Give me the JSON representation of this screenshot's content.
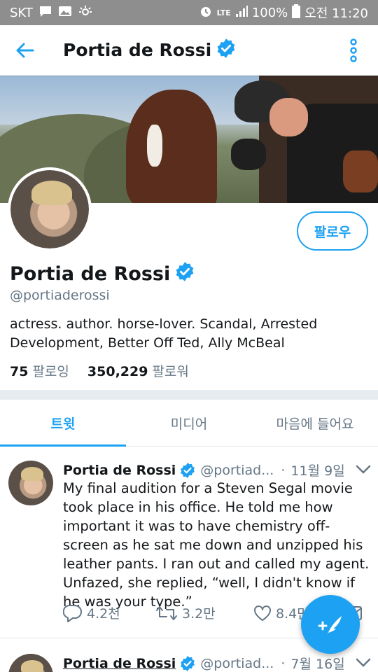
{
  "status_bar": {
    "carrier": "SKT",
    "network": "LTE",
    "battery": "100%",
    "time": "오전 11:20"
  },
  "header": {
    "title": "Portia de Rossi"
  },
  "profile": {
    "name": "Portia de Rossi",
    "handle": "@portiaderossi",
    "bio": "actress. author. horse-lover. Scandal, Arrested Development, Better Off Ted, Ally McBeal",
    "following_count": "75",
    "following_label": "팔로잉",
    "followers_count": "350,229",
    "followers_label": "팔로워",
    "follow_button": "팔로우"
  },
  "tabs": [
    {
      "label": "트윗",
      "active": true
    },
    {
      "label": "미디어",
      "active": false
    },
    {
      "label": "마음에 들어요",
      "active": false
    }
  ],
  "tweets": [
    {
      "name": "Portia de Rossi",
      "handle": "@portiad...",
      "separator": "·",
      "date": "11월 9일",
      "text": "My final audition for a Steven Segal movie took place in his office. He told me how important it was to have chemistry off-screen as he sat me down and unzipped his leather pants. I ran out and called my agent. Unfazed, she replied, “well, I didn't know if he was your type.”",
      "replies": "4.2천",
      "retweets": "3.2만",
      "likes": "8.4만"
    },
    {
      "name": "Portia de Rossi",
      "handle": "@portiad...",
      "separator": "·",
      "date": "7월 16일"
    }
  ],
  "colors": {
    "accent": "#1da1f2",
    "muted": "#657786"
  }
}
